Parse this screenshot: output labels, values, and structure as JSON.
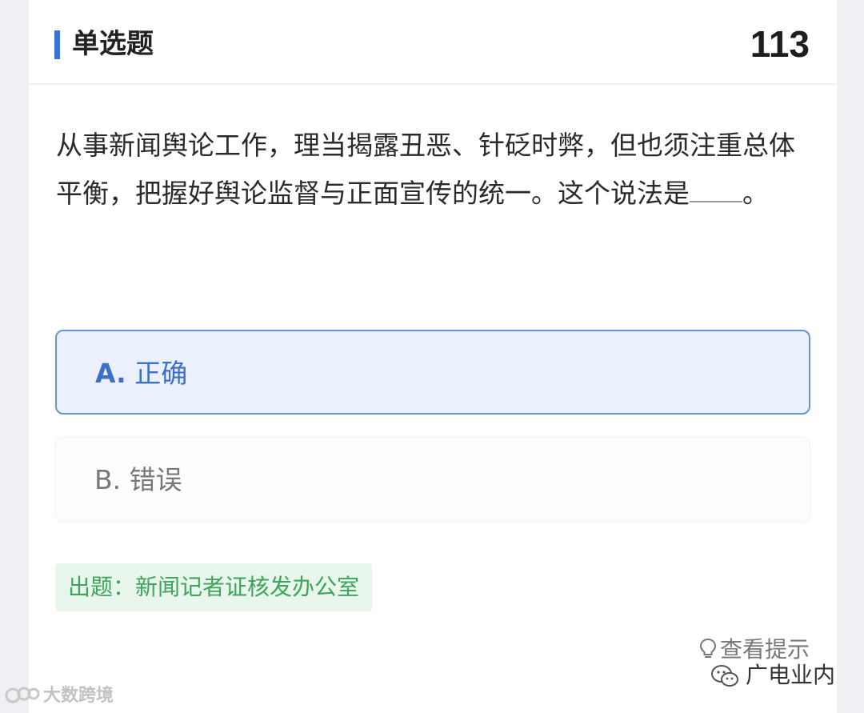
{
  "header": {
    "title": "单选题",
    "question_number": "113"
  },
  "question": {
    "text": "从事新闻舆论工作，理当揭露丑恶、针砭时弊，但也须注重总体平衡，把握好舆论监督与正面宣传的统一。这个说法是",
    "ending": "。"
  },
  "options": [
    {
      "letter": "A.",
      "label": "正确",
      "selected": true
    },
    {
      "letter": "B.",
      "label": "错误",
      "selected": false
    }
  ],
  "source": {
    "label": "出题：新闻记者证核发办公室"
  },
  "hint": {
    "label": "查看提示",
    "icon": "lightbulb-icon"
  },
  "watermarks": {
    "right": "广电业内",
    "left": "大数跨境"
  },
  "colors": {
    "accent": "#3a73d8",
    "selected_bg": "#ebf0fd",
    "selected_text": "#3d6fc9",
    "source_bg": "#e8f6ec",
    "source_text": "#3ea45c"
  }
}
